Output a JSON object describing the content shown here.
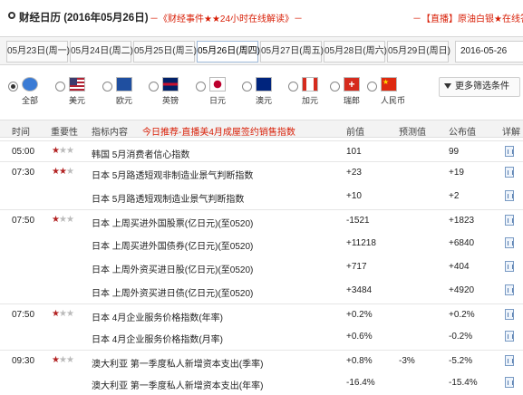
{
  "header": {
    "title": "财经日历 (2016年05月26日)",
    "promo_left": "－《财经事件★★24小时在线解读》－",
    "promo_right": "－【直播】原油白银★在线答疑"
  },
  "date_tabs": [
    {
      "label": "05月23日(周一)",
      "active": false
    },
    {
      "label": "05月24日(周二)",
      "active": false
    },
    {
      "label": "05月25日(周三)",
      "active": false
    },
    {
      "label": "05月26日(周四)",
      "active": true
    },
    {
      "label": "05月27日(周五)",
      "active": false
    },
    {
      "label": "05月28日(周六)",
      "active": false
    },
    {
      "label": "05月29日(周日)",
      "active": false
    }
  ],
  "date_input_value": "2016-05-26",
  "filters": [
    {
      "label": "全部",
      "selected": true,
      "flag": "globe-flag"
    },
    {
      "label": "美元",
      "selected": false,
      "flag": "us-flag"
    },
    {
      "label": "欧元",
      "selected": false,
      "flag": "eu-flag"
    },
    {
      "label": "英镑",
      "selected": false,
      "flag": "uk-flag"
    },
    {
      "label": "日元",
      "selected": false,
      "flag": "japan-flag"
    },
    {
      "label": "澳元",
      "selected": false,
      "flag": "australia-flag"
    },
    {
      "label": "加元",
      "selected": false,
      "flag": "canada-flag"
    },
    {
      "label": "瑞郎",
      "selected": false,
      "flag": "swiss-flag"
    },
    {
      "label": "人民币",
      "selected": false,
      "flag": "china-flag"
    }
  ],
  "more_filters_label": "更多筛选条件",
  "table": {
    "headers": {
      "time": "时间",
      "importance": "重要性",
      "indicator": "指标内容",
      "promo": "今日推荐-直播美4月成屋签约销售指数",
      "previous": "前值",
      "forecast": "预测值",
      "actual": "公布值",
      "detail": "详解"
    },
    "rows": [
      {
        "time": "05:00",
        "stars": 1,
        "indicator": "韩国  5月消费者信心指数",
        "previous": "101",
        "forecast": "",
        "actual": "99"
      },
      {
        "time": "07:30",
        "stars": 2,
        "indicator": "日本  5月路透短观非制造业景气判断指数",
        "previous": "+23",
        "forecast": "",
        "actual": "+19"
      },
      {
        "time": "",
        "stars": 0,
        "indicator": "日本  5月路透短观制造业景气判断指数",
        "previous": "+10",
        "forecast": "",
        "actual": "+2"
      },
      {
        "time": "07:50",
        "stars": 1,
        "indicator": "日本  上周买进外国股票(亿日元)(至0520)",
        "previous": "-1521",
        "forecast": "",
        "actual": "+1823"
      },
      {
        "time": "",
        "stars": 0,
        "indicator": "日本  上周买进外国债券(亿日元)(至0520)",
        "previous": "+11218",
        "forecast": "",
        "actual": "+6840"
      },
      {
        "time": "",
        "stars": 0,
        "indicator": "日本  上周外资买进日股(亿日元)(至0520)",
        "previous": "+717",
        "forecast": "",
        "actual": "+404"
      },
      {
        "time": "",
        "stars": 0,
        "indicator": "日本  上周外资买进日债(亿日元)(至0520)",
        "previous": "+3484",
        "forecast": "",
        "actual": "+4920"
      },
      {
        "time": "07:50",
        "stars": 1,
        "indicator": "日本  4月企业服务价格指数(年率)",
        "previous": "+0.2%",
        "forecast": "",
        "actual": "+0.2%"
      },
      {
        "time": "",
        "stars": 0,
        "indicator": "日本  4月企业服务价格指数(月率)",
        "previous": "+0.6%",
        "forecast": "",
        "actual": "-0.2%"
      },
      {
        "time": "09:30",
        "stars": 1,
        "indicator": "澳大利亚  第一季度私人新增资本支出(季率)",
        "previous": "+0.8%",
        "forecast": "-3%",
        "actual": "-5.2%"
      },
      {
        "time": "",
        "stars": 0,
        "indicator": "澳大利亚  第一季度私人新增资本支出(年率)",
        "previous": "-16.4%",
        "forecast": "",
        "actual": "-15.4%"
      }
    ]
  },
  "colors": {
    "accent_red": "#d81e06",
    "star_on": "#b22222",
    "star_off": "#bbbbbb",
    "header_bg": "#f3f3f3"
  }
}
